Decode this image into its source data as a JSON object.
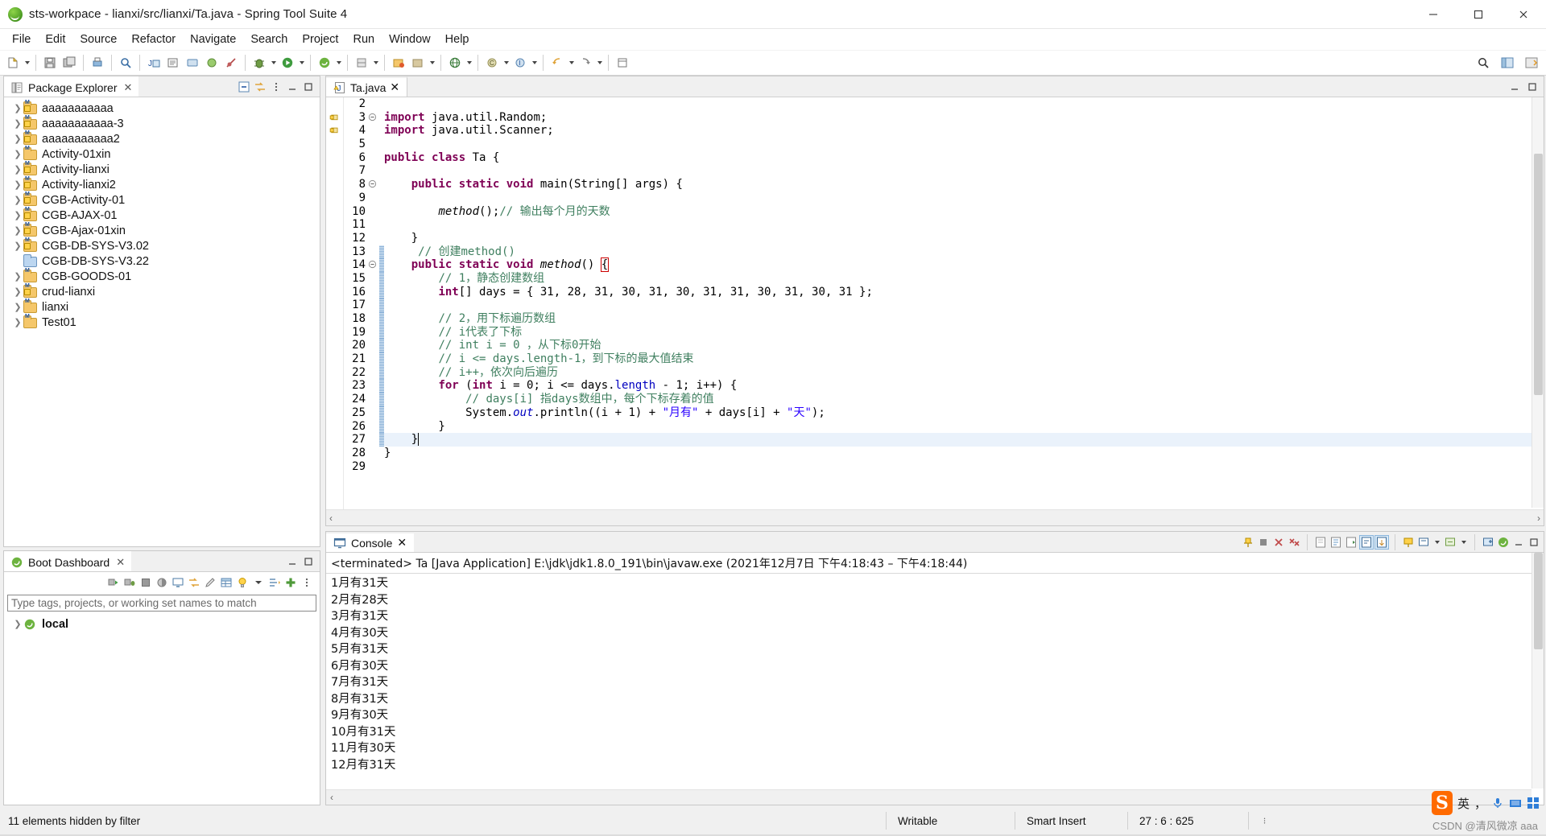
{
  "window": {
    "title": "sts-workpace - lianxi/src/lianxi/Ta.java - Spring Tool Suite 4",
    "minimize": "–",
    "maximize": "❐",
    "close": "✕"
  },
  "menubar": {
    "items": [
      "File",
      "Edit",
      "Source",
      "Refactor",
      "Navigate",
      "Search",
      "Project",
      "Run",
      "Window",
      "Help"
    ]
  },
  "package_explorer": {
    "title": "Package Explorer",
    "close_label": "✕",
    "items": [
      {
        "label": "aaaaaaaaaaa",
        "kind": "maven-warn",
        "expandable": true
      },
      {
        "label": "aaaaaaaaaaa-3",
        "kind": "maven-warn",
        "expandable": true
      },
      {
        "label": "aaaaaaaaaaa2",
        "kind": "maven-warn",
        "expandable": true
      },
      {
        "label": "Activity-01xin",
        "kind": "maven",
        "expandable": true
      },
      {
        "label": "Activity-lianxi",
        "kind": "maven-warn",
        "expandable": true
      },
      {
        "label": "Activity-lianxi2",
        "kind": "maven-warn",
        "expandable": true
      },
      {
        "label": "CGB-Activity-01",
        "kind": "maven-warn",
        "expandable": true
      },
      {
        "label": "CGB-AJAX-01",
        "kind": "maven-warn",
        "expandable": true
      },
      {
        "label": "CGB-Ajax-01xin",
        "kind": "maven-warn",
        "expandable": true
      },
      {
        "label": "CGB-DB-SYS-V3.02",
        "kind": "maven-warn",
        "expandable": true
      },
      {
        "label": "CGB-DB-SYS-V3.22",
        "kind": "closed",
        "expandable": false
      },
      {
        "label": "CGB-GOODS-01",
        "kind": "maven",
        "expandable": true
      },
      {
        "label": "crud-lianxi",
        "kind": "maven-warn",
        "expandable": true
      },
      {
        "label": "lianxi",
        "kind": "maven",
        "expandable": true
      },
      {
        "label": "Test01",
        "kind": "maven",
        "expandable": true
      }
    ]
  },
  "boot_dashboard": {
    "title": "Boot Dashboard",
    "close_label": "✕",
    "filter_placeholder": "Type tags, projects, or working set names to match",
    "filter_value": "",
    "tree": [
      {
        "label": "local",
        "expandable": true
      }
    ],
    "status": "11 elements hidden by filter"
  },
  "editor": {
    "tab_label": "Ta.java",
    "tab_close": "✕",
    "first_visible_line": 2,
    "lines": [
      {
        "n": 2,
        "text": ""
      },
      {
        "n": 3,
        "text": "import java.util.Random;",
        "fold": true,
        "ann": "warn"
      },
      {
        "n": 4,
        "text": "import java.util.Scanner;",
        "fold": false,
        "ann": "warn"
      },
      {
        "n": 5,
        "text": ""
      },
      {
        "n": 6,
        "text": "public class Ta {"
      },
      {
        "n": 7,
        "text": ""
      },
      {
        "n": 8,
        "text": "    public static void main(String[] args) {",
        "fold": true
      },
      {
        "n": 9,
        "text": ""
      },
      {
        "n": 10,
        "text": "        method();// 输出每个月的天数"
      },
      {
        "n": 11,
        "text": ""
      },
      {
        "n": 12,
        "text": "    }"
      },
      {
        "n": 13,
        "text": "     // 创建method()"
      },
      {
        "n": 14,
        "text": "    public static void method() {",
        "fold": true
      },
      {
        "n": 15,
        "text": "        // 1，静态创建数组"
      },
      {
        "n": 16,
        "text": "        int[] days = { 31, 28, 31, 30, 31, 30, 31, 31, 30, 31, 30, 31 };"
      },
      {
        "n": 17,
        "text": ""
      },
      {
        "n": 18,
        "text": "        // 2，用下标遍历数组"
      },
      {
        "n": 19,
        "text": "        // i代表了下标"
      },
      {
        "n": 20,
        "text": "        // int i = 0 ，从下标0开始"
      },
      {
        "n": 21,
        "text": "        // i <= days.length-1，到下标的最大值结束"
      },
      {
        "n": 22,
        "text": "        // i++，依次向后遍历"
      },
      {
        "n": 23,
        "text": "        for (int i = 0; i <= days.length - 1; i++) {"
      },
      {
        "n": 24,
        "text": "            // days[i] 指days数组中，每个下标存着的值"
      },
      {
        "n": 25,
        "text": "            System.out.println((i + 1) + \"月有\" + days[i] + \"天\");"
      },
      {
        "n": 26,
        "text": "        }"
      },
      {
        "n": 27,
        "text": "    }",
        "current": true
      },
      {
        "n": 28,
        "text": "}"
      },
      {
        "n": 29,
        "text": ""
      }
    ]
  },
  "console": {
    "title": "Console",
    "close_label": "✕",
    "header": "<terminated> Ta [Java Application] E:\\jdk\\jdk1.8.0_191\\bin\\javaw.exe  (2021年12月7日 下午4:18:43 – 下午4:18:44)",
    "output": [
      "1月有31天",
      "2月有28天",
      "3月有31天",
      "4月有30天",
      "5月有31天",
      "6月有30天",
      "7月有31天",
      "8月有31天",
      "9月有30天",
      "10月有31天",
      "11月有30天",
      "12月有31天"
    ]
  },
  "statusbar": {
    "left": "11 elements hidden by filter",
    "writable": "Writable",
    "insert_mode": "Smart Insert",
    "position": "27 : 6 : 625"
  },
  "tray": {
    "sogou_logo": "S",
    "lang": "英",
    "watermark": "CSDN @清风微凉 aaa"
  },
  "colors": {
    "keyword": "#7f0055",
    "comment": "#3f7f5f",
    "string": "#2a00ff",
    "field": "#0000c0",
    "accent": "#4a9a22",
    "tab_active": "#ffffff",
    "panel_bg": "#f0f0f0"
  }
}
